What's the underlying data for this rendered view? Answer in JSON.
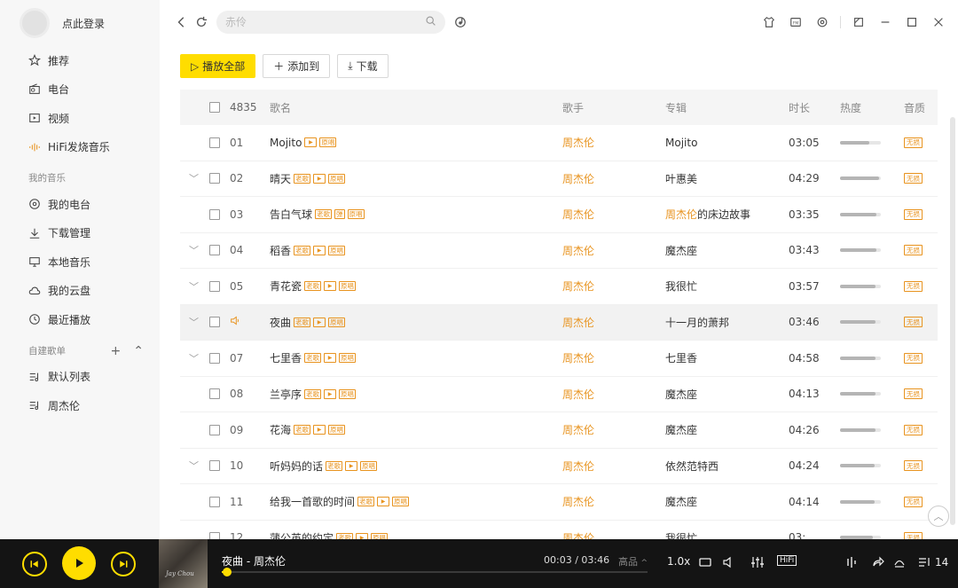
{
  "sidebar": {
    "login_text": "点此登录",
    "nav": [
      {
        "label": "推荐",
        "icon": "star-icon"
      },
      {
        "label": "电台",
        "icon": "radio-icon"
      },
      {
        "label": "视频",
        "icon": "video-icon"
      },
      {
        "label": "HiFi发烧音乐",
        "icon": "hifi-wave-icon"
      }
    ],
    "my_music_title": "我的音乐",
    "my_music": [
      {
        "label": "我的电台",
        "icon": "my-radio-icon"
      },
      {
        "label": "下载管理",
        "icon": "download-icon"
      },
      {
        "label": "本地音乐",
        "icon": "monitor-icon"
      },
      {
        "label": "我的云盘",
        "icon": "cloud-icon"
      },
      {
        "label": "最近播放",
        "icon": "clock-icon"
      }
    ],
    "playlists_title": "自建歌单",
    "playlists": [
      {
        "label": "默认列表",
        "icon": "playlist-icon"
      },
      {
        "label": "周杰伦",
        "icon": "playlist-icon"
      }
    ]
  },
  "topbar": {
    "search_placeholder": "赤伶"
  },
  "actions": {
    "play_all": "播放全部",
    "add_to": "添加到",
    "download": "下载"
  },
  "table": {
    "headers": {
      "count": "4835",
      "title": "歌名",
      "artist": "歌手",
      "album": "专辑",
      "duration": "时长",
      "heat": "热度",
      "quality": "音质"
    },
    "rows": [
      {
        "num": "01",
        "title": "Mojito",
        "tags": [
          "play",
          "原唱"
        ],
        "artist": "周杰伦",
        "album": "Mojito",
        "duration": "03:05",
        "heat": 0.72,
        "quality": "无损",
        "chevron": false
      },
      {
        "num": "02",
        "title": "晴天",
        "tags": [
          "老歌",
          "play",
          "原唱"
        ],
        "artist": "周杰伦",
        "album": "叶惠美",
        "duration": "04:29",
        "heat": 0.95,
        "quality": "无损",
        "chevron": true
      },
      {
        "num": "03",
        "title": "告白气球",
        "tags": [
          "老歌",
          "弹",
          "原唱"
        ],
        "artist": "周杰伦",
        "album_hl": "周杰伦",
        "album": "的床边故事",
        "duration": "03:35",
        "heat": 0.9,
        "quality": "无损",
        "chevron": false
      },
      {
        "num": "04",
        "title": "稻香",
        "tags": [
          "老歌",
          "play",
          "原唱"
        ],
        "artist": "周杰伦",
        "album": "魔杰座",
        "duration": "03:43",
        "heat": 0.9,
        "quality": "无损",
        "chevron": true
      },
      {
        "num": "05",
        "title": "青花瓷",
        "tags": [
          "老歌",
          "play",
          "原唱"
        ],
        "artist": "周杰伦",
        "album": "我很忙",
        "duration": "03:57",
        "heat": 0.88,
        "quality": "无损",
        "chevron": true
      },
      {
        "num": "",
        "title": "夜曲",
        "tags": [
          "老歌",
          "play",
          "原唱"
        ],
        "artist": "周杰伦",
        "album": "十一月的萧邦",
        "duration": "03:46",
        "heat": 0.88,
        "quality": "无损",
        "chevron": true,
        "playing": true
      },
      {
        "num": "07",
        "title": "七里香",
        "tags": [
          "老歌",
          "play",
          "原唱"
        ],
        "artist": "周杰伦",
        "album": "七里香",
        "duration": "04:58",
        "heat": 0.88,
        "quality": "无损",
        "chevron": true
      },
      {
        "num": "08",
        "title": "兰亭序",
        "tags": [
          "老歌",
          "play",
          "原唱"
        ],
        "artist": "周杰伦",
        "album": "魔杰座",
        "duration": "04:13",
        "heat": 0.86,
        "quality": "无损",
        "chevron": false
      },
      {
        "num": "09",
        "title": "花海",
        "tags": [
          "老歌",
          "play",
          "原唱"
        ],
        "artist": "周杰伦",
        "album": "魔杰座",
        "duration": "04:26",
        "heat": 0.86,
        "quality": "无损",
        "chevron": false
      },
      {
        "num": "10",
        "title": "听妈妈的话",
        "tags": [
          "老歌",
          "play",
          "原唱"
        ],
        "artist": "周杰伦",
        "album": "依然范特西",
        "duration": "04:24",
        "heat": 0.84,
        "quality": "无损",
        "chevron": true
      },
      {
        "num": "11",
        "title": "给我一首歌的时间",
        "tags": [
          "老歌",
          "play",
          "原唱"
        ],
        "artist": "周杰伦",
        "album": "魔杰座",
        "duration": "04:14",
        "heat": 0.84,
        "quality": "无损",
        "chevron": false
      },
      {
        "num": "12",
        "title": "蒲公英的约定",
        "tags": [
          "老歌",
          "play",
          "原唱"
        ],
        "artist": "周杰伦",
        "album": "我很忙",
        "duration": "03:  ",
        "heat": 0.8,
        "quality": "无损",
        "chevron": false
      }
    ]
  },
  "player": {
    "now_playing": "夜曲 - 周杰伦",
    "time": "00:03 / 03:46",
    "quality": "高品",
    "speed": "1.0x",
    "progress": 0.013,
    "hifi_label": "HiFi",
    "count": "14",
    "cover_text": "Jay Chou",
    "accent": "#ffdd00"
  },
  "colors": {
    "accent_yellow": "#ffdd00",
    "artist_orange": "#e8931e"
  }
}
